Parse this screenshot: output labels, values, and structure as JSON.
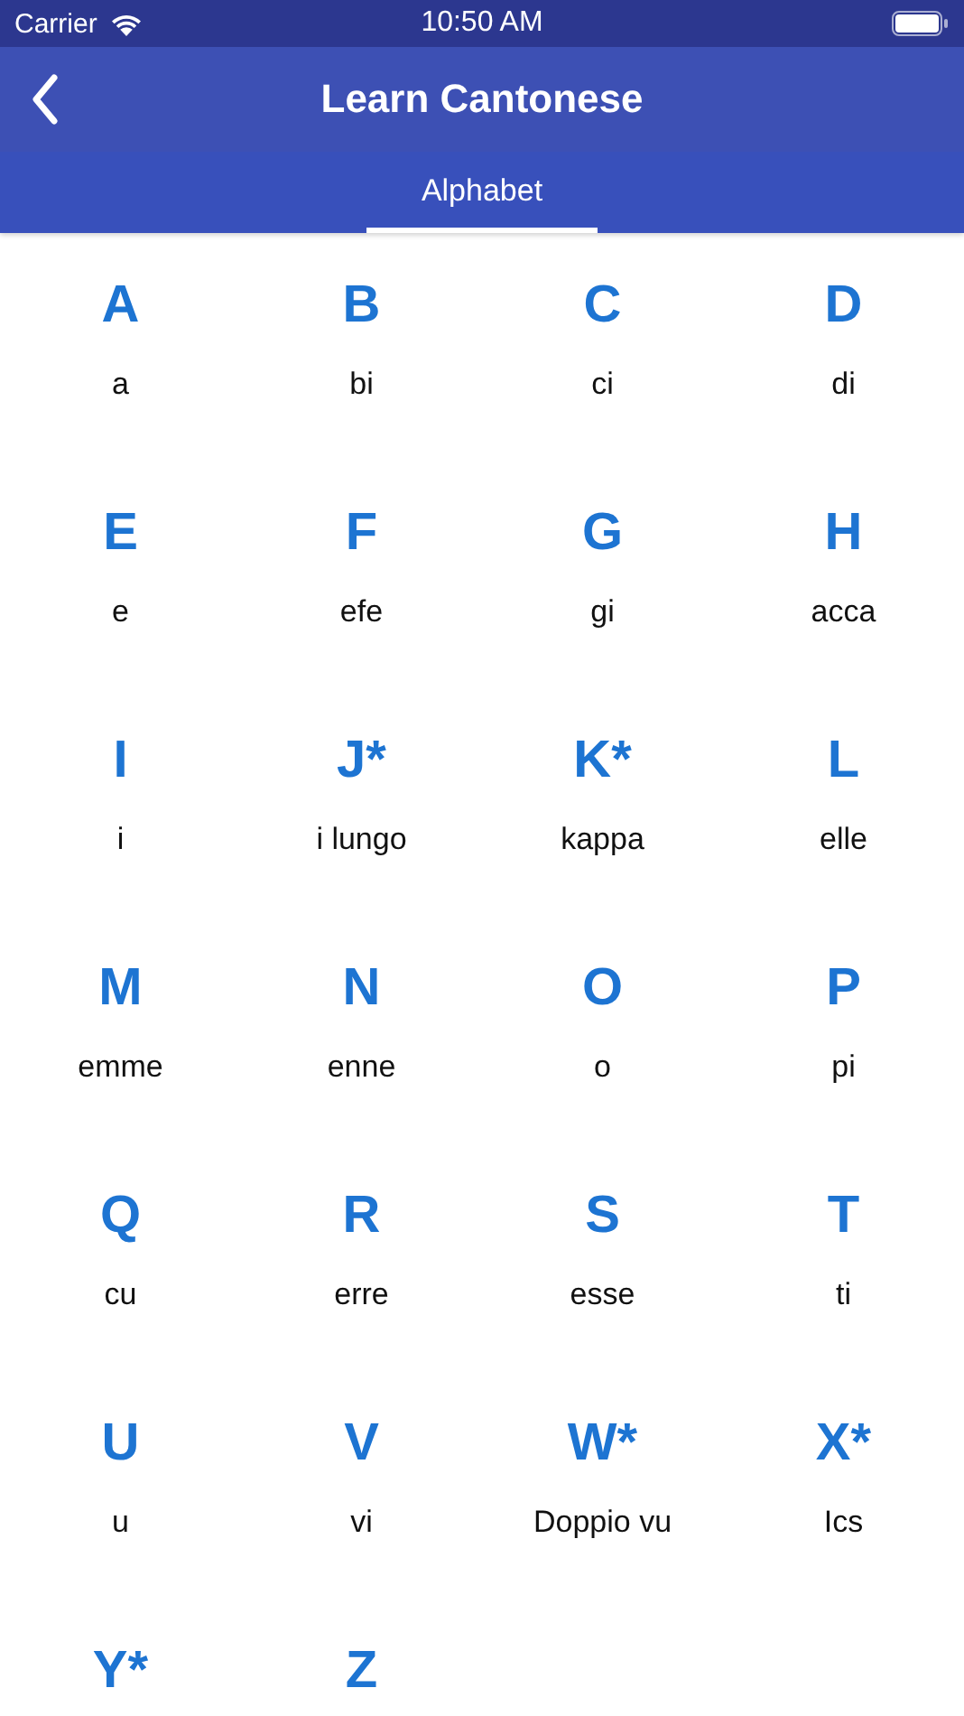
{
  "status_bar": {
    "carrier": "Carrier",
    "time": "10:50 AM"
  },
  "nav": {
    "title": "Learn Cantonese"
  },
  "tabs": [
    {
      "label": "Alphabet",
      "selected": true
    }
  ],
  "letters": [
    {
      "letter": "A",
      "name": "a"
    },
    {
      "letter": "B",
      "name": "bi"
    },
    {
      "letter": "C",
      "name": "ci"
    },
    {
      "letter": "D",
      "name": "di"
    },
    {
      "letter": "E",
      "name": "e"
    },
    {
      "letter": "F",
      "name": "efe"
    },
    {
      "letter": "G",
      "name": "gi"
    },
    {
      "letter": "H",
      "name": "acca"
    },
    {
      "letter": "I",
      "name": "i"
    },
    {
      "letter": "J*",
      "name": "i lungo"
    },
    {
      "letter": "K*",
      "name": "kappa"
    },
    {
      "letter": "L",
      "name": "elle"
    },
    {
      "letter": "M",
      "name": "emme"
    },
    {
      "letter": "N",
      "name": "enne"
    },
    {
      "letter": "O",
      "name": "o"
    },
    {
      "letter": "P",
      "name": "pi"
    },
    {
      "letter": "Q",
      "name": "cu"
    },
    {
      "letter": "R",
      "name": "erre"
    },
    {
      "letter": "S",
      "name": "esse"
    },
    {
      "letter": "T",
      "name": "ti"
    },
    {
      "letter": "U",
      "name": "u"
    },
    {
      "letter": "V",
      "name": "vi"
    },
    {
      "letter": "W*",
      "name": "Doppio vu"
    },
    {
      "letter": "X*",
      "name": "Ics"
    },
    {
      "letter": "Y*"
    },
    {
      "letter": "Z"
    }
  ]
}
